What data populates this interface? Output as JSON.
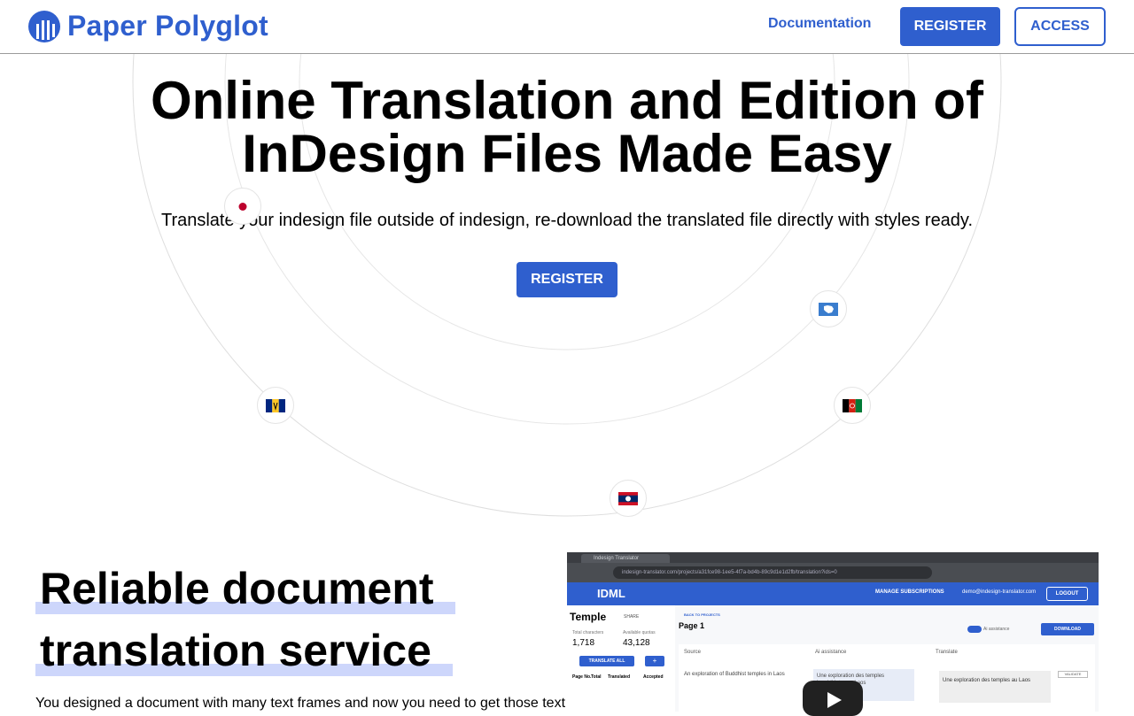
{
  "header": {
    "brand": "Paper Polyglot",
    "nav_documentation": "Documentation",
    "register_label": "REGISTER",
    "access_label": "ACCESS"
  },
  "hero": {
    "title_line1": "Online Translation and Edition of",
    "title_line2": "InDesign Files Made Easy",
    "subtitle": "Translate your indesign file outside of indesign, re-download the translated file directly with styles ready.",
    "register_label": "REGISTER",
    "flags": [
      "japan-flag-icon",
      "antarctica-flag-icon",
      "barbados-flag-icon",
      "afghanistan-flag-icon",
      "laos-flag-icon"
    ]
  },
  "section": {
    "title_line1": "Reliable document",
    "title_line2": "translation service",
    "body": "You designed a document with many text frames and now you need to get those text"
  },
  "video": {
    "tab_title": "Indesign Translator",
    "url": "indesign-translator.com/projects/a31fce98-1ee5-4f7a-bd4b-89c9d1e1d2fb/translation?ids=0",
    "app_brand": "IDML",
    "manage_subscriptions": "MANAGE SUBSCRIPTIONS",
    "email": "demo@indesign-translator.com",
    "logout": "LOGOUT",
    "project_name": "Temple",
    "share": "SHARE",
    "total_characters_label": "Total characters",
    "total_characters_value": "1,718",
    "available_quotas_label": "Available quotas",
    "available_quotas_value": "43,128",
    "translate_all": "TRANSLATE ALL",
    "col_page": "Page No.",
    "col_total": "Total",
    "col_translated": "Translated",
    "col_accepted": "Accepted",
    "back_to_projects": "BACK TO PROJECTS",
    "page_title": "Page 1",
    "ai_assistance_toggle": "Ai assistance",
    "download": "DOWNLOAD",
    "head_source": "Source",
    "head_ai": "Ai assistance",
    "head_translate": "Translate",
    "source_text": "An exploration of Buddhist temples in Laos",
    "ai_text": "Une exploration des temples bouddhistes au Laos",
    "translate_text": "Une exploration des temples au Laos",
    "validate": "VALIDATE"
  },
  "colors": {
    "brand_blue": "#2f5fce",
    "highlight": "#cdd6fb"
  }
}
